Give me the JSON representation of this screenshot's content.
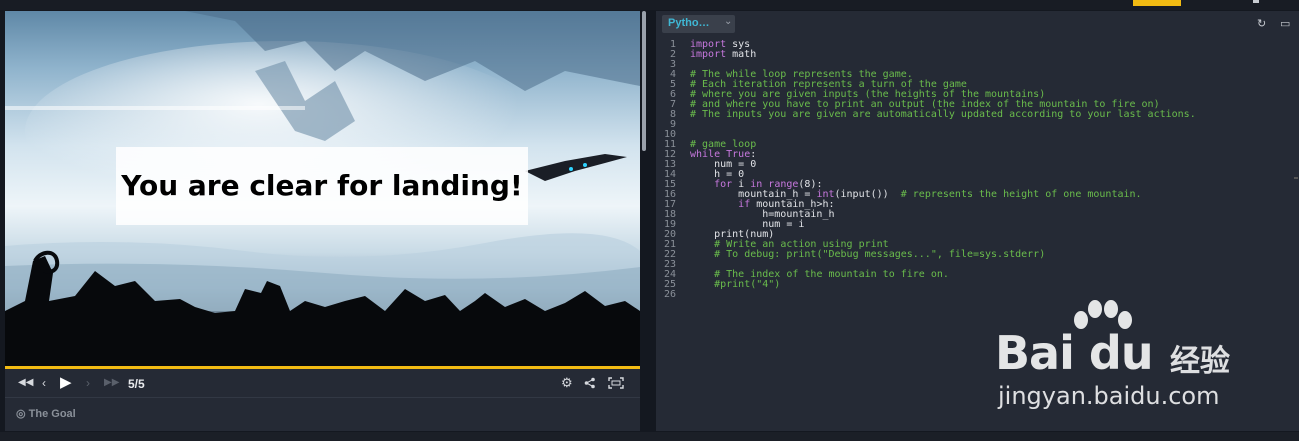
{
  "viewer": {
    "banner_text": "You are clear for landing!",
    "frame_counter": "5/5",
    "goal_label": "◎ The Goal",
    "icons": [
      "rewind-icon",
      "step-back-icon",
      "play-icon",
      "step-forward-icon",
      "fast-forward-icon",
      "gear-icon",
      "share-icon",
      "fullscreen-icon"
    ]
  },
  "editor": {
    "language": "Pytho…",
    "line_numbers": [
      "1",
      "2",
      "3",
      "4",
      "5",
      "6",
      "7",
      "8",
      "9",
      "10",
      "11",
      "12",
      "13",
      "14",
      "15",
      "16",
      "17",
      "18",
      "19",
      "20",
      "21",
      "22",
      "23",
      "24",
      "25",
      "26"
    ],
    "lines": [
      "import sys",
      "import math",
      "",
      "# The while loop represents the game.",
      "# Each iteration represents a turn of the game",
      "# where you are given inputs (the heights of the mountains)",
      "# and where you have to print an output (the index of the mountain to fire on)",
      "# The inputs you are given are automatically updated according to your last actions.",
      "",
      "",
      "# game loop",
      "while True:",
      "    num = 0",
      "    h = 0",
      "    for i in range(8):",
      "        mountain_h = int(input())  # represents the height of one mountain.",
      "        if mountain_h>h:",
      "            h=mountain_h",
      "            num = i",
      "    print(num)",
      "    # Write an action using print",
      "    # To debug: print(\"Debug messages...\", file=sys.stderr)",
      "",
      "    # The index of the mountain to fire on.",
      "    #print(\"4\")",
      ""
    ]
  },
  "watermark": {
    "logo": "Bai du",
    "cn": "经验",
    "url": "jingyan.baidu.com"
  },
  "colors": {
    "accent": "#f2bb13",
    "panel_bg": "#252a35",
    "comment": "#6abc4c",
    "keyword": "#c678dd",
    "lang_label": "#3fb7d4"
  }
}
